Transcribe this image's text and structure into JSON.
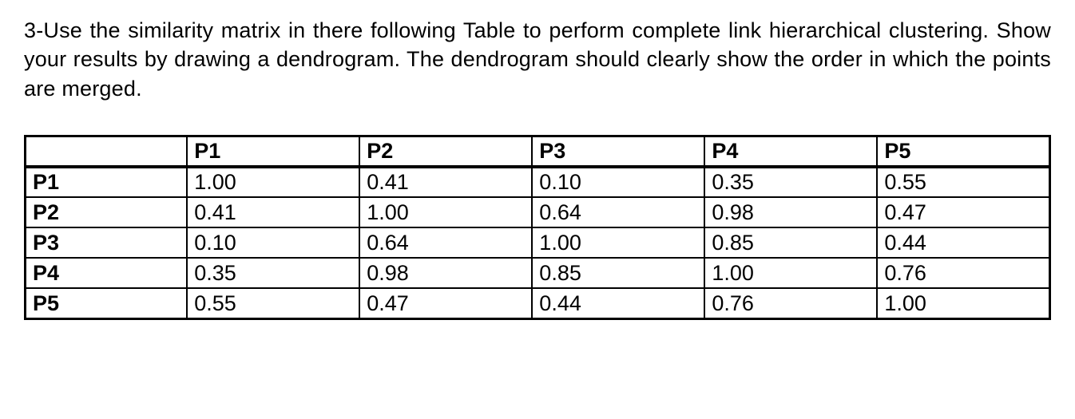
{
  "question": "3-Use the similarity matrix in there following Table to perform complete link hierarchical clustering. Show your results by drawing a dendrogram. The dendrogram should clearly show the order in which the points are merged.",
  "chart_data": {
    "type": "table",
    "columns": [
      "P1",
      "P2",
      "P3",
      "P4",
      "P5"
    ],
    "rows": [
      {
        "label": "P1",
        "values": [
          "1.00",
          "0.41",
          "0.10",
          "0.35",
          "0.55"
        ]
      },
      {
        "label": "P2",
        "values": [
          "0.41",
          "1.00",
          "0.64",
          "0.98",
          "0.47"
        ]
      },
      {
        "label": "P3",
        "values": [
          "0.10",
          "0.64",
          "1.00",
          "0.85",
          "0.44"
        ]
      },
      {
        "label": "P4",
        "values": [
          "0.35",
          "0.98",
          "0.85",
          "1.00",
          "0.76"
        ]
      },
      {
        "label": "P5",
        "values": [
          "0.55",
          "0.47",
          "0.44",
          "0.76",
          "1.00"
        ]
      }
    ]
  }
}
